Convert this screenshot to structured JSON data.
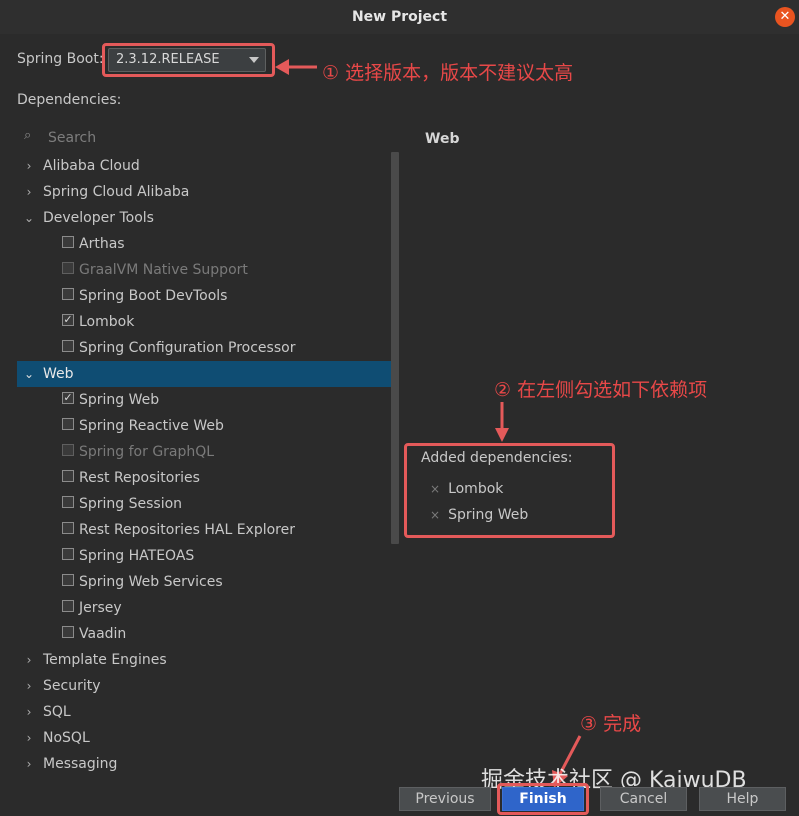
{
  "window": {
    "title": "New Project"
  },
  "spring_boot": {
    "label": "Spring Boot:",
    "version": "2.3.12.RELEASE"
  },
  "dependencies_label": "Dependencies:",
  "search": {
    "placeholder": "Search"
  },
  "tree": {
    "alibaba_cloud": "Alibaba Cloud",
    "spring_cloud_alibaba": "Spring Cloud Alibaba",
    "developer_tools": "Developer Tools",
    "arthas": "Arthas",
    "graalvm": "GraalVM Native Support",
    "devtools": "Spring Boot DevTools",
    "lombok": "Lombok",
    "config_processor": "Spring Configuration Processor",
    "web": "Web",
    "spring_web": "Spring Web",
    "reactive_web": "Spring Reactive Web",
    "graphql": "Spring for GraphQL",
    "rest_repos": "Rest Repositories",
    "spring_session": "Spring Session",
    "hal_explorer": "Rest Repositories HAL Explorer",
    "hateoas": "Spring HATEOAS",
    "web_services": "Spring Web Services",
    "jersey": "Jersey",
    "vaadin": "Vaadin",
    "template_engines": "Template Engines",
    "security": "Security",
    "sql": "SQL",
    "nosql": "NoSQL",
    "messaging": "Messaging"
  },
  "right_panel": {
    "category_title": "Web",
    "added_title": "Added dependencies:",
    "added": [
      "Lombok",
      "Spring Web"
    ]
  },
  "annotations": {
    "step1": "① 选择版本，版本不建议太高",
    "step2": "② 在左侧勾选如下依赖项",
    "step3": "③ 完成"
  },
  "buttons": {
    "previous": "Previous",
    "finish": "Finish",
    "cancel": "Cancel",
    "help": "Help"
  },
  "watermark": "掘金技术社区 @ KaiwuDB",
  "colors": {
    "selection": "#0f4d73",
    "annotation_red": "#e84848",
    "primary_button": "#2f65ca",
    "close_button": "#e95420"
  },
  "icons": {
    "check": "✓",
    "remove": "×",
    "chevron_right": "›",
    "chevron_down": "⌄"
  }
}
